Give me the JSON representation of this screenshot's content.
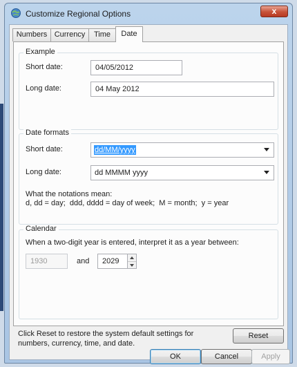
{
  "window": {
    "title": "Customize Regional Options",
    "close_glyph": "x"
  },
  "tabs": [
    {
      "label": "Numbers",
      "active": false
    },
    {
      "label": "Currency",
      "active": false
    },
    {
      "label": "Time",
      "active": false
    },
    {
      "label": "Date",
      "active": true
    }
  ],
  "example": {
    "title": "Example",
    "short_label": "Short date:",
    "short_value": "04/05/2012",
    "long_label": "Long date:",
    "long_value": "04 May 2012"
  },
  "date_formats": {
    "title": "Date formats",
    "short_label": "Short date:",
    "short_value": "dd/MM/yyyy",
    "long_label": "Long date:",
    "long_value": "dd MMMM yyyy",
    "notation_heading": "What the notations mean:",
    "notation_text": "d, dd = day;  ddd, dddd = day of week;  M = month;  y = year"
  },
  "calendar": {
    "title": "Calendar",
    "instruction": "When a two-digit year is entered, interpret it as a year between:",
    "start_year": "1930",
    "and_label": "and",
    "end_year": "2029"
  },
  "reset": {
    "text_line1": "Click Reset to restore the system default settings for",
    "text_line2": "numbers, currency, time, and date.",
    "button_label": "Reset"
  },
  "footer": {
    "ok_label": "OK",
    "cancel_label": "Cancel",
    "apply_label": "Apply"
  },
  "colors": {
    "selection": "#3399ff",
    "close_button": "#c65238"
  }
}
